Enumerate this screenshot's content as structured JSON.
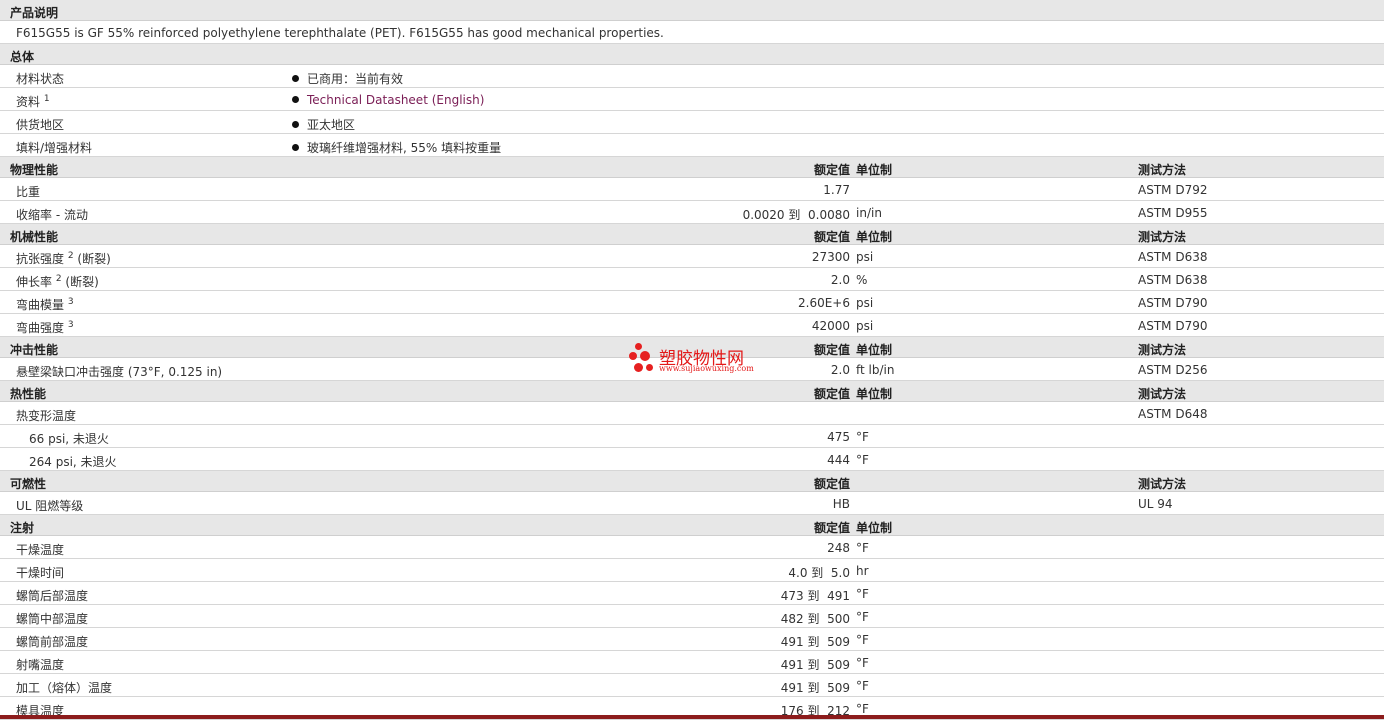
{
  "sections": {
    "desc_title": "产品说明",
    "desc_text": "F615G55 is GF 55% reinforced polyethylene terephthalate (PET). F615G55 has good mechanical properties.",
    "general": {
      "title": "总体",
      "rows": [
        {
          "label": "材料状态",
          "sup": "",
          "value": "已商用：当前有效"
        },
        {
          "label": "资料",
          "sup": "1",
          "value": "Technical Datasheet (English)"
        },
        {
          "label": "供货地区",
          "sup": "",
          "value": "亚太地区"
        },
        {
          "label": "填料/增强材料",
          "sup": "",
          "value": "玻璃纤维增强材料, 55% 填料按重量"
        }
      ]
    },
    "physical": {
      "title": "物理性能",
      "h_val": "额定值",
      "h_unit": "单位制",
      "h_test": "测试方法",
      "rows": [
        {
          "label": "比重",
          "sup": "",
          "suffix": "",
          "value": "1.77",
          "unit": "",
          "test": "ASTM D792"
        },
        {
          "label": "收缩率",
          "sup": "",
          "suffix": " - 流动",
          "value": "0.0020 到  0.0080",
          "unit": "in/in",
          "test": "ASTM D955"
        }
      ]
    },
    "mechanical": {
      "title": "机械性能",
      "h_val": "额定值",
      "h_unit": "单位制",
      "h_test": "测试方法",
      "rows": [
        {
          "label": "抗张强度",
          "sup": "2",
          "suffix": " (断裂)",
          "value": "27300",
          "unit": "psi",
          "test": "ASTM D638"
        },
        {
          "label": "伸长率",
          "sup": "2",
          "suffix": " (断裂)",
          "value": "2.0",
          "unit": "%",
          "test": "ASTM D638"
        },
        {
          "label": "弯曲模量",
          "sup": "3",
          "suffix": "",
          "value": "2.60E+6",
          "unit": "psi",
          "test": "ASTM D790"
        },
        {
          "label": "弯曲强度",
          "sup": "3",
          "suffix": "",
          "value": "42000",
          "unit": "psi",
          "test": "ASTM D790"
        }
      ]
    },
    "impact": {
      "title": "冲击性能",
      "h_val": "额定值",
      "h_unit": "单位制",
      "h_test": "测试方法",
      "rows": [
        {
          "label": "悬壁梁缺口冲击强度",
          "sup": "",
          "suffix": " (73°F, 0.125 in)",
          "value": "2.0",
          "unit": "ft lb/in",
          "test": "ASTM D256"
        }
      ]
    },
    "thermal": {
      "title": "热性能",
      "h_val": "额定值",
      "h_unit": "单位制",
      "h_test": "测试方法",
      "rows": [
        {
          "label": "热变形温度",
          "sup": "",
          "suffix": "",
          "value": "",
          "unit": "",
          "test": "ASTM D648",
          "sub": false
        },
        {
          "label": "66 psi, 未退火",
          "sup": "",
          "suffix": "",
          "value": "475",
          "unit": "°F",
          "test": "",
          "sub": true
        },
        {
          "label": "264 psi, 未退火",
          "sup": "",
          "suffix": "",
          "value": "444",
          "unit": "°F",
          "test": "",
          "sub": true
        }
      ]
    },
    "flammability": {
      "title": "可燃性",
      "h_val": "额定值",
      "h_test": "测试方法",
      "rows": [
        {
          "label": "UL 阻燃等级",
          "sup": "",
          "suffix": "",
          "value": "HB",
          "unit": "",
          "test": "UL 94"
        }
      ]
    },
    "injection": {
      "title": "注射",
      "h_val": "额定值",
      "h_unit": "单位制",
      "rows": [
        {
          "label": "干燥温度",
          "value": "248",
          "unit": "°F"
        },
        {
          "label": "干燥时间",
          "value": "4.0 到  5.0",
          "unit": "hr"
        },
        {
          "label": "螺筒后部温度",
          "value": "473 到  491",
          "unit": "°F"
        },
        {
          "label": "螺筒中部温度",
          "value": "482 到  500",
          "unit": "°F"
        },
        {
          "label": "螺筒前部温度",
          "value": "491 到  509",
          "unit": "°F"
        },
        {
          "label": "射嘴温度",
          "value": "491 到  509",
          "unit": "°F"
        },
        {
          "label": "加工（熔体）温度",
          "value": "491 到  509",
          "unit": "°F"
        },
        {
          "label": "模具温度",
          "value": "176 到  212",
          "unit": "°F"
        }
      ]
    }
  },
  "watermark": {
    "cn": "塑胶物性网",
    "en": "www.sujiaowuxing.com"
  },
  "colors": {
    "section_bg": "#e7e7e7",
    "link": "#7a1d55",
    "watermark": "#e31818",
    "footer_bar": "#8c1c1c"
  }
}
